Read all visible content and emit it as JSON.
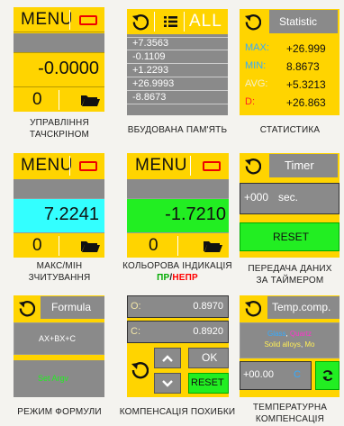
{
  "colors": {
    "yellow": "#ffd400",
    "gray": "#8a8a8a",
    "dark_gray": "#707070",
    "cyan": "#33ffff",
    "green": "#22ee22",
    "dark_green": "#00aa00",
    "red": "#ff0000",
    "accent_blue": "#33aaff",
    "accent_pink": "#ff33cc"
  },
  "panels": {
    "p1": {
      "menu_label": "MENU",
      "value": "-0.0000",
      "counter": "0",
      "caption_line1": "УПРАВЛІННЯ",
      "caption_line2": "ТАЧСКРІНОМ"
    },
    "p2": {
      "all_label": "ALL",
      "values": [
        "+7.3563",
        "-0.1109",
        "+1.2293",
        "+26.9993",
        "-8.8673"
      ],
      "caption": "ВБУДОВАНА ПАМ'ЯТЬ"
    },
    "p3": {
      "title": "Statistic",
      "rows": [
        {
          "label": "MAX:",
          "value": "+26.999"
        },
        {
          "label": "MIN:",
          "value": "8.8673"
        },
        {
          "label": "AVG:",
          "value": "+5.3213"
        },
        {
          "label": "D:",
          "value": "+26.863"
        }
      ],
      "caption": "СТАТИСТИКА"
    },
    "p4": {
      "menu_label": "MENU",
      "value": "7.2241",
      "counter": "0",
      "caption_line1": "МАКС/МІН",
      "caption_line2": "ЗЧИТУВАННЯ"
    },
    "p5": {
      "menu_label": "MENU",
      "value": "-1.7210",
      "counter": "0",
      "caption_line1": "КОЛЬОРОВА ІНДИКАЦІЯ",
      "pass_label": "ПР",
      "slash": "/",
      "fail_label": "НЕПР"
    },
    "p6": {
      "title": "Timer",
      "time_value": "+000",
      "time_unit": "sec.",
      "reset_label": "RESET",
      "caption_line1": "ПЕРЕДАЧА ДАНИХ",
      "caption_line2": "ЗА ТАЙМЕРОМ"
    },
    "p7": {
      "title": "Formula",
      "formula": "AX+BX+C",
      "set_label": "Set Argv",
      "caption": "РЕЖИМ ФОРМУЛИ"
    },
    "p8": {
      "o_label": "O:",
      "o_value": "0.8970",
      "c_label": "C:",
      "c_value": "0.8920",
      "ok_label": "OK",
      "reset_label": "RESET",
      "caption": "КОМПЕНСАЦІЯ ПОХИБКИ"
    },
    "p9": {
      "title": "Temp.comp.",
      "material_glass": "Glass",
      "material_sep": ", ",
      "material_quartz": "Quartz",
      "material_solid": "Solid alloys",
      "material_sep2": ", ",
      "material_mo": "Mo",
      "value": "+00.00",
      "unit": "C",
      "caption_line1": "ТЕМПЕРАТУРНА",
      "caption_line2": "КОМПЕНСАЦІЯ"
    }
  }
}
